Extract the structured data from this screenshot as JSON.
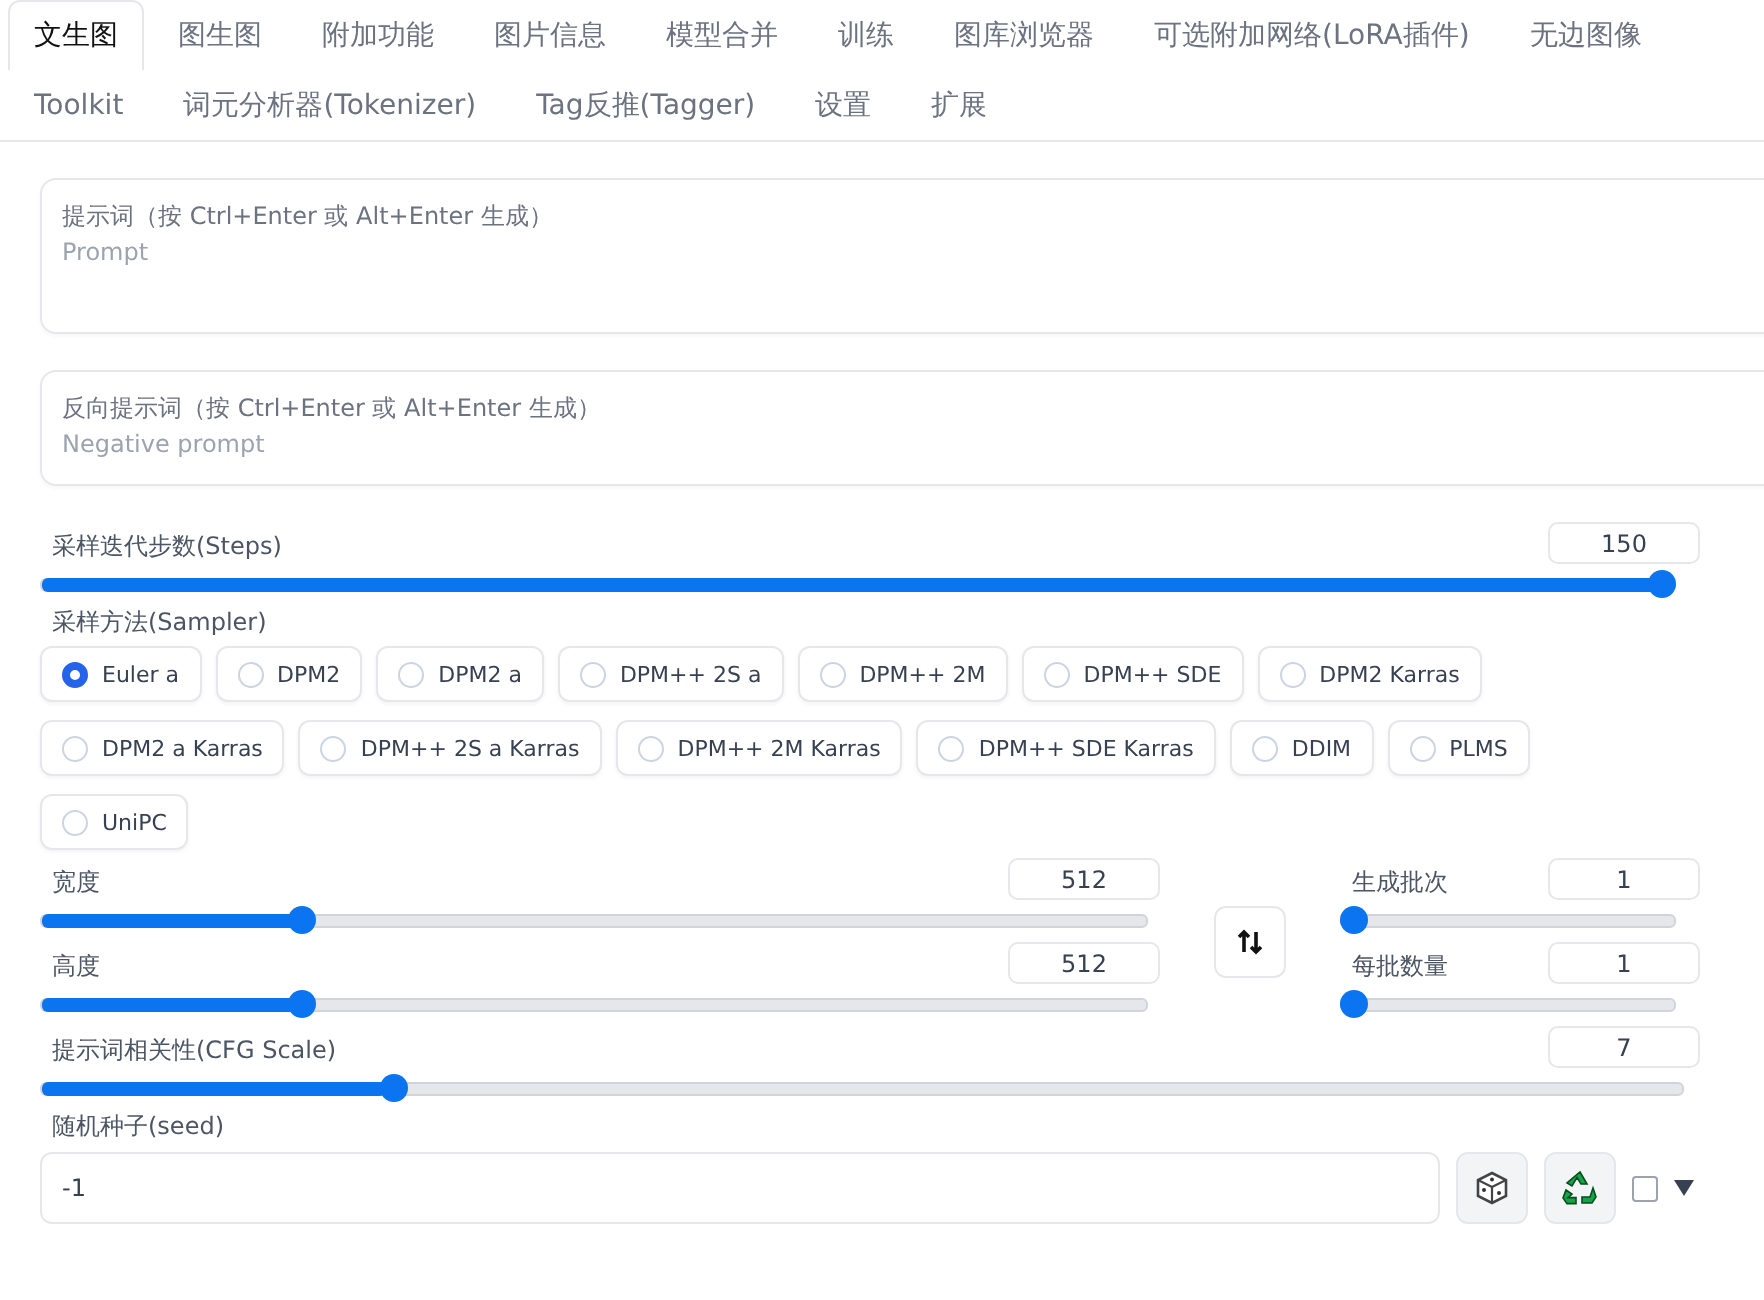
{
  "tab_rows": [
    [
      {
        "label": "文生图",
        "selected": true
      },
      {
        "label": "图生图",
        "selected": false
      },
      {
        "label": "附加功能",
        "selected": false
      },
      {
        "label": "图片信息",
        "selected": false
      },
      {
        "label": "模型合并",
        "selected": false
      },
      {
        "label": "训练",
        "selected": false
      },
      {
        "label": "图库浏览器",
        "selected": false
      },
      {
        "label": "可选附加网络(LoRA插件)",
        "selected": false
      },
      {
        "label": "无边图像",
        "selected": false
      }
    ],
    [
      {
        "label": "Toolkit",
        "selected": false
      },
      {
        "label": "词元分析器(Tokenizer)",
        "selected": false
      },
      {
        "label": "Tag反推(Tagger)",
        "selected": false
      },
      {
        "label": "设置",
        "selected": false
      },
      {
        "label": "扩展",
        "selected": false
      }
    ]
  ],
  "prompt": {
    "label": "提示词（按 Ctrl+Enter 或 Alt+Enter 生成）",
    "placeholder": "Prompt"
  },
  "negative_prompt": {
    "label": "反向提示词（按 Ctrl+Enter 或 Alt+Enter 生成）",
    "placeholder": "Negative prompt"
  },
  "steps": {
    "label": "采样迭代步数(Steps)",
    "value": "150",
    "level": 1.0
  },
  "sampler": {
    "label": "采样方法(Sampler)",
    "options": [
      {
        "label": "Euler a",
        "selected": true
      },
      {
        "label": "DPM2",
        "selected": false
      },
      {
        "label": "DPM2 a",
        "selected": false
      },
      {
        "label": "DPM++ 2S a",
        "selected": false
      },
      {
        "label": "DPM++ 2M",
        "selected": false
      },
      {
        "label": "DPM++ SDE",
        "selected": false
      },
      {
        "label": "DPM2 Karras",
        "selected": false
      },
      {
        "label": "DPM2 a Karras",
        "selected": false
      },
      {
        "label": "DPM++ 2S a Karras",
        "selected": false
      },
      {
        "label": "DPM++ 2M Karras",
        "selected": false
      },
      {
        "label": "DPM++ SDE Karras",
        "selected": false
      },
      {
        "label": "DDIM",
        "selected": false
      },
      {
        "label": "PLMS",
        "selected": false
      },
      {
        "label": "UniPC",
        "selected": false
      }
    ]
  },
  "width": {
    "label": "宽度",
    "value": "512",
    "level": 0.23
  },
  "height": {
    "label": "高度",
    "value": "512",
    "level": 0.23
  },
  "batch_count": {
    "label": "生成批次",
    "value": "1",
    "level": 0
  },
  "batch_size": {
    "label": "每批数量",
    "value": "1",
    "level": 0
  },
  "cfg_scale": {
    "label": "提示词相关性(CFG Scale)",
    "value": "7",
    "level": 0.21
  },
  "seed": {
    "label": "随机种子(seed)",
    "value": "-1",
    "extra_checked": false
  }
}
